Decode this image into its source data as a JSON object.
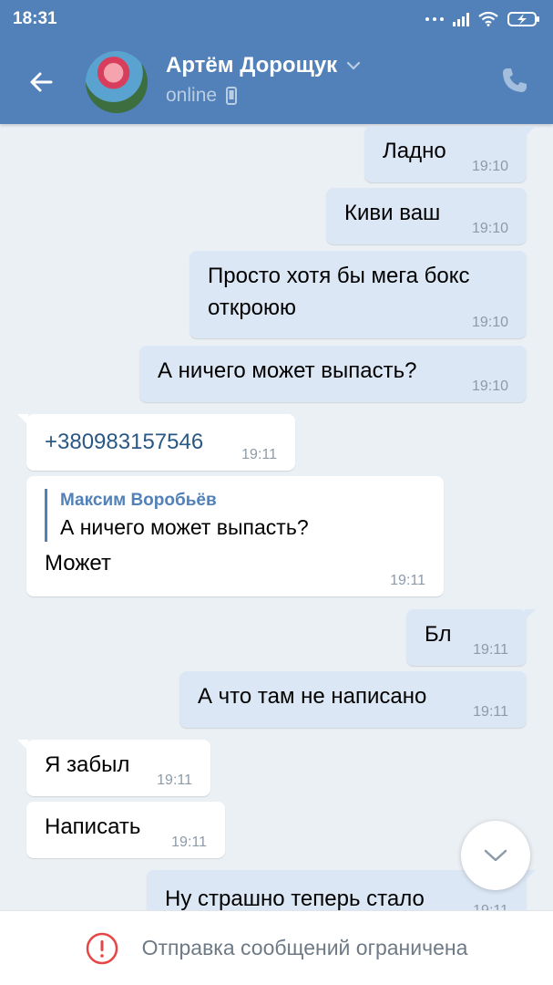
{
  "status_bar": {
    "time": "18:31"
  },
  "header": {
    "contact_name": "Артём Дорощук",
    "status": "online"
  },
  "messages": [
    {
      "text": "Ладно",
      "time": "19:10"
    },
    {
      "text": "Киви ваш",
      "time": "19:10"
    },
    {
      "text": "Просто хотя бы мега бокс откроюю",
      "time": "19:10"
    },
    {
      "text": "А ничего может выпасть?",
      "time": "19:10"
    },
    {
      "text": "+380983157546",
      "time": "19:11"
    },
    {
      "reply_author": "Максим Воробьёв",
      "reply_text": "А ничего может выпасть?",
      "text": "Может",
      "time": "19:11"
    },
    {
      "text": "Бл",
      "time": "19:11"
    },
    {
      "text": "А что там не написано",
      "time": "19:11"
    },
    {
      "text": "Я забыл",
      "time": "19:11"
    },
    {
      "text": "Написать",
      "time": "19:11"
    },
    {
      "text": "Ну страшно теперь стало",
      "time": "19:11"
    }
  ],
  "bottom_bar": {
    "notice": "Отправка сообщений ограничена"
  },
  "colors": {
    "header": "#5181b8",
    "outgoing": "#dce7f5",
    "incoming": "#ffffff",
    "background": "#ebf0f5",
    "alert": "#e64646"
  }
}
